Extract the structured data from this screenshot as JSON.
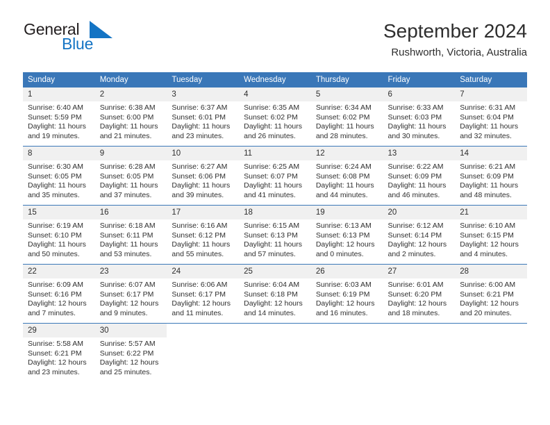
{
  "logo": {
    "word_general": "General",
    "word_blue": "Blue",
    "flag_icon": "blue-flag-triangle",
    "brand_color": "#1474c4"
  },
  "header": {
    "title": "September 2024",
    "subtitle": "Rushworth, Victoria, Australia"
  },
  "theme": {
    "header_blue": "#3a77b8",
    "daynum_band": "#f0f0f0",
    "text": "#2e2e2e"
  },
  "calendar": {
    "weekday_headers": [
      "Sunday",
      "Monday",
      "Tuesday",
      "Wednesday",
      "Thursday",
      "Friday",
      "Saturday"
    ],
    "weeks": [
      [
        {
          "day": "1",
          "sunrise": "Sunrise: 6:40 AM",
          "sunset": "Sunset: 5:59 PM",
          "daylight": "Daylight: 11 hours and 19 minutes."
        },
        {
          "day": "2",
          "sunrise": "Sunrise: 6:38 AM",
          "sunset": "Sunset: 6:00 PM",
          "daylight": "Daylight: 11 hours and 21 minutes."
        },
        {
          "day": "3",
          "sunrise": "Sunrise: 6:37 AM",
          "sunset": "Sunset: 6:01 PM",
          "daylight": "Daylight: 11 hours and 23 minutes."
        },
        {
          "day": "4",
          "sunrise": "Sunrise: 6:35 AM",
          "sunset": "Sunset: 6:02 PM",
          "daylight": "Daylight: 11 hours and 26 minutes."
        },
        {
          "day": "5",
          "sunrise": "Sunrise: 6:34 AM",
          "sunset": "Sunset: 6:02 PM",
          "daylight": "Daylight: 11 hours and 28 minutes."
        },
        {
          "day": "6",
          "sunrise": "Sunrise: 6:33 AM",
          "sunset": "Sunset: 6:03 PM",
          "daylight": "Daylight: 11 hours and 30 minutes."
        },
        {
          "day": "7",
          "sunrise": "Sunrise: 6:31 AM",
          "sunset": "Sunset: 6:04 PM",
          "daylight": "Daylight: 11 hours and 32 minutes."
        }
      ],
      [
        {
          "day": "8",
          "sunrise": "Sunrise: 6:30 AM",
          "sunset": "Sunset: 6:05 PM",
          "daylight": "Daylight: 11 hours and 35 minutes."
        },
        {
          "day": "9",
          "sunrise": "Sunrise: 6:28 AM",
          "sunset": "Sunset: 6:05 PM",
          "daylight": "Daylight: 11 hours and 37 minutes."
        },
        {
          "day": "10",
          "sunrise": "Sunrise: 6:27 AM",
          "sunset": "Sunset: 6:06 PM",
          "daylight": "Daylight: 11 hours and 39 minutes."
        },
        {
          "day": "11",
          "sunrise": "Sunrise: 6:25 AM",
          "sunset": "Sunset: 6:07 PM",
          "daylight": "Daylight: 11 hours and 41 minutes."
        },
        {
          "day": "12",
          "sunrise": "Sunrise: 6:24 AM",
          "sunset": "Sunset: 6:08 PM",
          "daylight": "Daylight: 11 hours and 44 minutes."
        },
        {
          "day": "13",
          "sunrise": "Sunrise: 6:22 AM",
          "sunset": "Sunset: 6:09 PM",
          "daylight": "Daylight: 11 hours and 46 minutes."
        },
        {
          "day": "14",
          "sunrise": "Sunrise: 6:21 AM",
          "sunset": "Sunset: 6:09 PM",
          "daylight": "Daylight: 11 hours and 48 minutes."
        }
      ],
      [
        {
          "day": "15",
          "sunrise": "Sunrise: 6:19 AM",
          "sunset": "Sunset: 6:10 PM",
          "daylight": "Daylight: 11 hours and 50 minutes."
        },
        {
          "day": "16",
          "sunrise": "Sunrise: 6:18 AM",
          "sunset": "Sunset: 6:11 PM",
          "daylight": "Daylight: 11 hours and 53 minutes."
        },
        {
          "day": "17",
          "sunrise": "Sunrise: 6:16 AM",
          "sunset": "Sunset: 6:12 PM",
          "daylight": "Daylight: 11 hours and 55 minutes."
        },
        {
          "day": "18",
          "sunrise": "Sunrise: 6:15 AM",
          "sunset": "Sunset: 6:13 PM",
          "daylight": "Daylight: 11 hours and 57 minutes."
        },
        {
          "day": "19",
          "sunrise": "Sunrise: 6:13 AM",
          "sunset": "Sunset: 6:13 PM",
          "daylight": "Daylight: 12 hours and 0 minutes."
        },
        {
          "day": "20",
          "sunrise": "Sunrise: 6:12 AM",
          "sunset": "Sunset: 6:14 PM",
          "daylight": "Daylight: 12 hours and 2 minutes."
        },
        {
          "day": "21",
          "sunrise": "Sunrise: 6:10 AM",
          "sunset": "Sunset: 6:15 PM",
          "daylight": "Daylight: 12 hours and 4 minutes."
        }
      ],
      [
        {
          "day": "22",
          "sunrise": "Sunrise: 6:09 AM",
          "sunset": "Sunset: 6:16 PM",
          "daylight": "Daylight: 12 hours and 7 minutes."
        },
        {
          "day": "23",
          "sunrise": "Sunrise: 6:07 AM",
          "sunset": "Sunset: 6:17 PM",
          "daylight": "Daylight: 12 hours and 9 minutes."
        },
        {
          "day": "24",
          "sunrise": "Sunrise: 6:06 AM",
          "sunset": "Sunset: 6:17 PM",
          "daylight": "Daylight: 12 hours and 11 minutes."
        },
        {
          "day": "25",
          "sunrise": "Sunrise: 6:04 AM",
          "sunset": "Sunset: 6:18 PM",
          "daylight": "Daylight: 12 hours and 14 minutes."
        },
        {
          "day": "26",
          "sunrise": "Sunrise: 6:03 AM",
          "sunset": "Sunset: 6:19 PM",
          "daylight": "Daylight: 12 hours and 16 minutes."
        },
        {
          "day": "27",
          "sunrise": "Sunrise: 6:01 AM",
          "sunset": "Sunset: 6:20 PM",
          "daylight": "Daylight: 12 hours and 18 minutes."
        },
        {
          "day": "28",
          "sunrise": "Sunrise: 6:00 AM",
          "sunset": "Sunset: 6:21 PM",
          "daylight": "Daylight: 12 hours and 20 minutes."
        }
      ],
      [
        {
          "day": "29",
          "sunrise": "Sunrise: 5:58 AM",
          "sunset": "Sunset: 6:21 PM",
          "daylight": "Daylight: 12 hours and 23 minutes."
        },
        {
          "day": "30",
          "sunrise": "Sunrise: 5:57 AM",
          "sunset": "Sunset: 6:22 PM",
          "daylight": "Daylight: 12 hours and 25 minutes."
        },
        {
          "day": "",
          "sunrise": "",
          "sunset": "",
          "daylight": ""
        },
        {
          "day": "",
          "sunrise": "",
          "sunset": "",
          "daylight": ""
        },
        {
          "day": "",
          "sunrise": "",
          "sunset": "",
          "daylight": ""
        },
        {
          "day": "",
          "sunrise": "",
          "sunset": "",
          "daylight": ""
        },
        {
          "day": "",
          "sunrise": "",
          "sunset": "",
          "daylight": ""
        }
      ]
    ]
  }
}
